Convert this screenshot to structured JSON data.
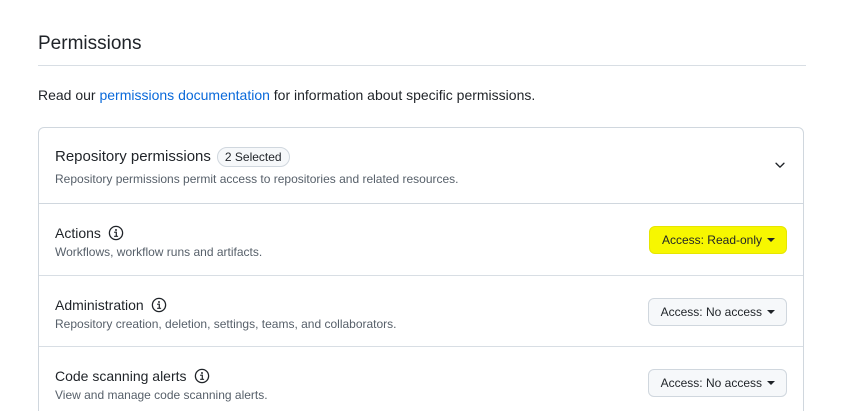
{
  "section": {
    "title": "Permissions",
    "intro_prefix": "Read our ",
    "intro_link": "permissions documentation",
    "intro_suffix": " for information about specific permissions."
  },
  "panel": {
    "title": "Repository permissions",
    "selected_count": "2 Selected",
    "description": "Repository permissions permit access to repositories and related resources.",
    "chevron_icon": "chevron-down-icon"
  },
  "permissions": [
    {
      "name": "Actions",
      "description": "Workflows, workflow runs and artifacts.",
      "access": "Access: Read-only",
      "highlighted": true
    },
    {
      "name": "Administration",
      "description": "Repository creation, deletion, settings, teams, and collaborators.",
      "access": "Access: No access",
      "highlighted": false
    },
    {
      "name": "Code scanning alerts",
      "description": "View and manage code scanning alerts.",
      "access": "Access: No access",
      "highlighted": false
    }
  ],
  "colors": {
    "link": "#0969da",
    "highlight": "#f7f700",
    "border": "#d0d7de",
    "muted_text": "#57606a"
  }
}
